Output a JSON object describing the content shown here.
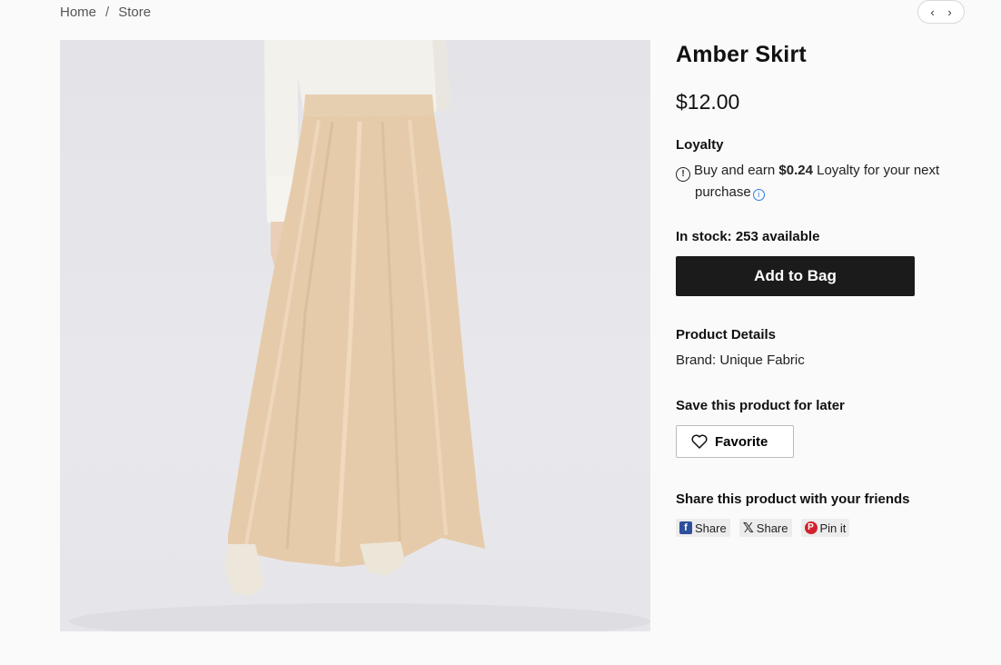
{
  "breadcrumb": {
    "home": "Home",
    "separator": "/",
    "current": "Store"
  },
  "pager": {
    "prev": "‹",
    "next": "›"
  },
  "product": {
    "title": "Amber Skirt",
    "price": "$12.00",
    "image_alt": "Amber satin maxi skirt worn with white blouse"
  },
  "loyalty": {
    "heading": "Loyalty",
    "text_before": "Buy and earn",
    "amount": "$0.24",
    "text_after": "Loyalty for your next",
    "text_wrap": "purchase"
  },
  "stock": {
    "text": "In stock: 253 available"
  },
  "actions": {
    "add_to_bag": "Add to Bag"
  },
  "details": {
    "heading": "Product Details",
    "brand": "Brand: Unique Fabric"
  },
  "save": {
    "heading": "Save this product for later",
    "favorite": "Favorite"
  },
  "share": {
    "heading": "Share this product with your friends",
    "facebook": "Share",
    "x": "Share",
    "pinterest": "Pin it"
  },
  "colors": {
    "skirt": "#e6cbab",
    "blouse": "#f3f1ec",
    "button": "#1b1b1b",
    "facebook": "#2d4f9c",
    "pinterest": "#d1222e",
    "info": "#2f7de1"
  }
}
